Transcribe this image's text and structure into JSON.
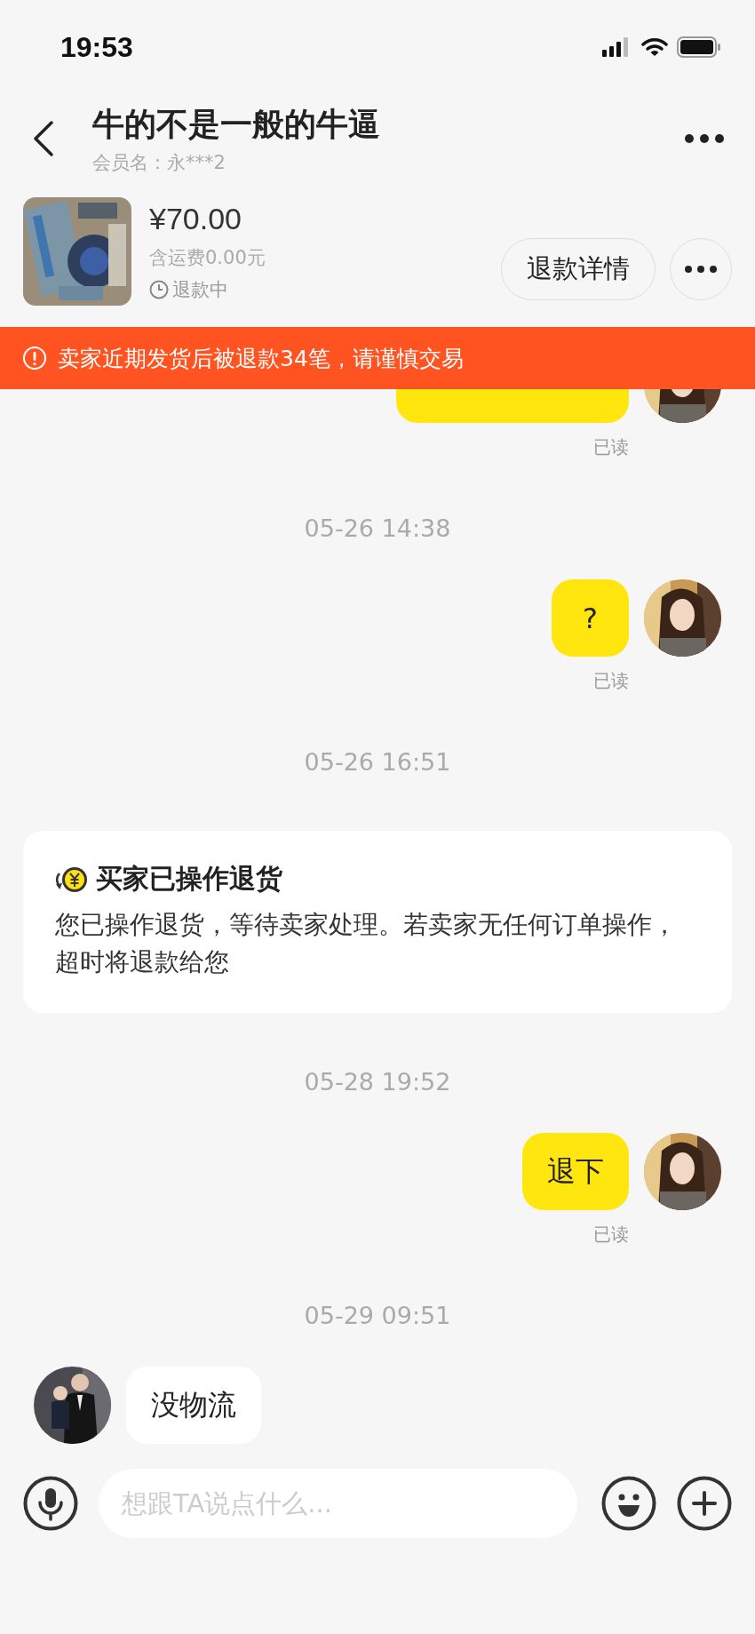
{
  "status_bar": {
    "time": "19:53"
  },
  "header": {
    "title": "牛的不是一般的牛逼",
    "subtitle": "会员名：永***2"
  },
  "order": {
    "price": "¥70.00",
    "shipping": "含运费0.00元",
    "status": "退款中",
    "button": "退款详情"
  },
  "warning": {
    "text": "卖家近期发货后被退款34笔，请谨慎交易"
  },
  "messages": [
    {
      "kind": "outgoing_clipped",
      "receipt": "已读"
    },
    {
      "kind": "time",
      "text": "05-26 14:38"
    },
    {
      "kind": "outgoing",
      "text": "?",
      "receipt": "已读"
    },
    {
      "kind": "time",
      "text": "05-26 16:51"
    },
    {
      "kind": "notice",
      "title": "买家已操作退货",
      "text": "您已操作退货，等待卖家处理。若卖家无任何订单操作，超时将退款给您"
    },
    {
      "kind": "time",
      "text": "05-28 19:52"
    },
    {
      "kind": "outgoing",
      "text": "退下",
      "receipt": "已读"
    },
    {
      "kind": "time",
      "text": "05-29 09:51"
    },
    {
      "kind": "incoming",
      "text": "没物流"
    }
  ],
  "input": {
    "placeholder": "想跟TA说点什么..."
  }
}
